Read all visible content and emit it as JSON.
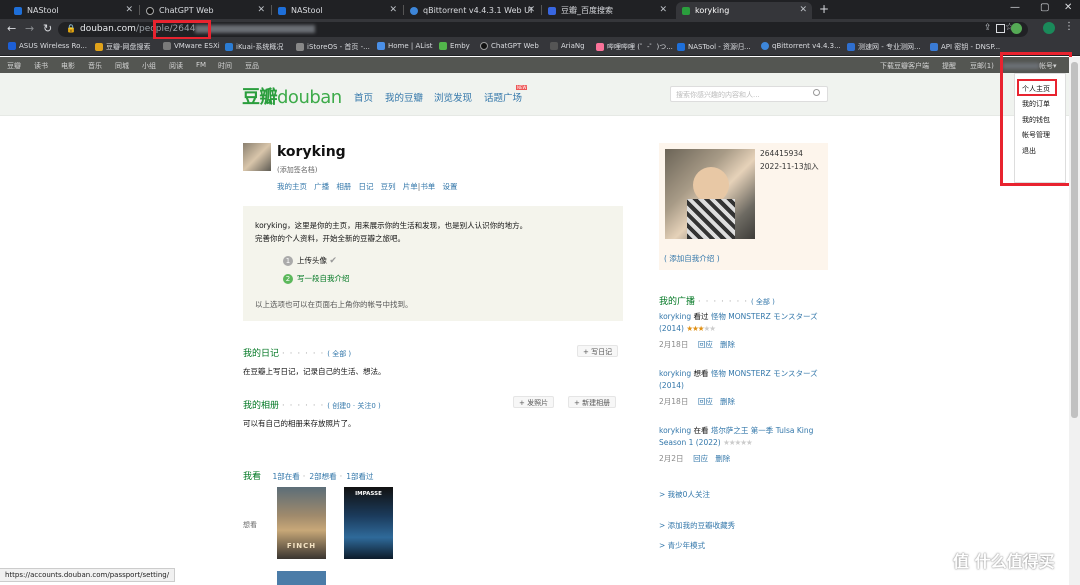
{
  "tabs": [
    {
      "title": "NAStool",
      "color": "#1e6fd9"
    },
    {
      "title": "ChatGPT Web",
      "color": "#111"
    },
    {
      "title": "NAStool",
      "color": "#1e6fd9"
    },
    {
      "title": "qBittorrent v4.4.3.1 Web UI",
      "color": "#3d86d9"
    },
    {
      "title": "豆瓣_百度搜索",
      "color": "#3866e0"
    },
    {
      "title": "koryking",
      "color": "#2a9e3d"
    }
  ],
  "new_tab_label": "+",
  "url": {
    "host": "douban.com",
    "path": "/people/",
    "id_visible": "2644"
  },
  "bookmarks": [
    {
      "label": "ASUS Wireless Ro...",
      "color": "#1d5fd6"
    },
    {
      "label": "豆瓣-网盘搜索",
      "color": "#e0a21a"
    },
    {
      "label": "VMware ESXi",
      "color": "#7a7a7a"
    },
    {
      "label": "iKuai-系统概况",
      "color": "#2b7cd4"
    },
    {
      "label": "iStoreOS - 首页 -...",
      "color": "#888"
    },
    {
      "label": "Home | AList",
      "color": "#4a8fe7"
    },
    {
      "label": "Emby",
      "color": "#52b54b"
    },
    {
      "label": "ChatGPT Web",
      "color": "#111"
    },
    {
      "label": "AriaNg",
      "color": "#555"
    },
    {
      "label": "哔哩哔哩 (゜-゜)つ...",
      "color": "#fb7299"
    },
    {
      "label": "NASTool - 资源归...",
      "color": "#1e6fd9"
    },
    {
      "label": "qBittorrent v4.4.3...",
      "color": "#3d86d9"
    },
    {
      "label": "测速网 - 专业测网...",
      "color": "#2f6fd0"
    },
    {
      "label": "API 密钥 - DNSP...",
      "color": "#3a7bd5"
    }
  ],
  "topnav": [
    "豆瓣",
    "读书",
    "电影",
    "音乐",
    "同城",
    "小组",
    "阅读",
    "FM",
    "时间",
    "豆品"
  ],
  "topnav_right": {
    "download": "下载豆瓣客户端",
    "remind": "提醒",
    "mail": "豆邮(1)",
    "account": "帐号"
  },
  "header": {
    "logo_cn": "豆瓣",
    "logo_en": "douban",
    "nav": [
      "首页",
      "我的豆瓣",
      "浏览发现",
      "话题广场"
    ],
    "new_badge": "NEW",
    "search_placeholder": "搜索你感兴趣的内容和人..."
  },
  "profile": {
    "name": "koryking",
    "signature": "(添加签名档)",
    "tabs": [
      "我的主页",
      "广播",
      "相册",
      "日记",
      "豆列",
      "片单",
      "书单",
      "设置"
    ],
    "separator": "|"
  },
  "intro": {
    "line1": "koryking，这里是你的主页，用来展示你的生活和发现，也是别人认识你的地方。",
    "line2": "完善你的个人资料，开始全新的豆瓣之旅吧。",
    "step1_num": "1",
    "step1": "上传头像",
    "step2_num": "2",
    "step2": "写一段自我介绍",
    "footer": "以上选项也可以在页面右上角你的帐号中找到。"
  },
  "diary": {
    "title": "我的日记",
    "all": "( 全部 )",
    "button": "+ 写日记",
    "text": "在豆瓣上写日记，记录自己的生活、想法。"
  },
  "album": {
    "title": "我的相册",
    "meta": "( 创建0 · 关注0 )",
    "btn_upload": "+ 发照片",
    "btn_new": "+ 新建相册",
    "text": "可以有自己的相册来存放照片了。"
  },
  "watching": {
    "title": "我看",
    "links": [
      "1部在看",
      "2部想看",
      "1部看过"
    ],
    "row_label": "想看",
    "poster1_title": "FINCH",
    "poster2_title": "IMPASSE"
  },
  "side": {
    "user_id": "264415934",
    "joined": "2022-11-13加入",
    "add_intro": "( 添加自我介绍 )"
  },
  "broadcast": {
    "title": "我的广播",
    "all": "( 全部 )",
    "items": [
      {
        "user": "koryking",
        "verb": "看过",
        "work": "怪物 MONSTERZ モンスターズ (2014)",
        "stars": 3,
        "date": "2月18日",
        "reply": "回应",
        "delete": "删除"
      },
      {
        "user": "koryking",
        "verb": "想看",
        "work": "怪物 MONSTERZ モンスターズ (2014)",
        "stars": 0,
        "date": "2月18日",
        "reply": "回应",
        "delete": "删除"
      },
      {
        "user": "koryking",
        "verb": "在看",
        "work": "塔尔萨之王 第一季 Tulsa King Season 1 (2022)",
        "stars": 0,
        "date": "2月2日",
        "reply": "回应",
        "delete": "删除"
      }
    ]
  },
  "side_links": [
    "> 我被0人关注",
    "> 添加我的豆瓣收藏秀",
    "> 青少年模式"
  ],
  "dropdown": [
    "个人主页",
    "我的订单",
    "我的钱包",
    "帐号管理",
    "退出"
  ],
  "status_url": "https://accounts.douban.com/passport/setting/",
  "watermark": "值 什么值得买",
  "colors": {
    "accent_green": "#2a9e3d",
    "link": "#3377aa",
    "highlight_red": "#e8232f"
  }
}
